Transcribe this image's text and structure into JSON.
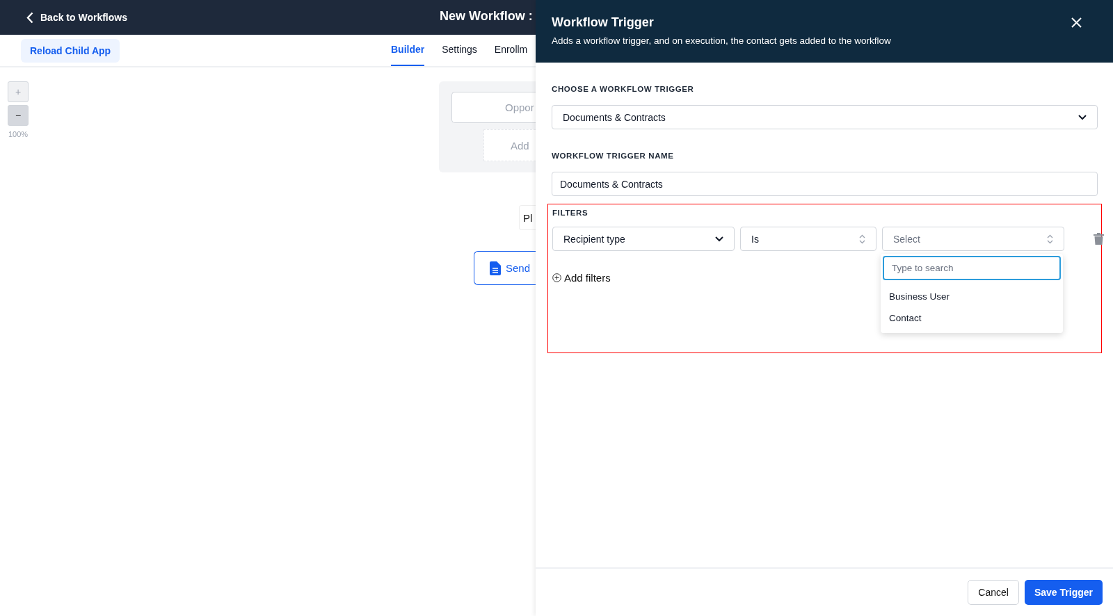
{
  "topbar": {
    "back_label": "Back to Workflows",
    "title": "New Workflow :"
  },
  "toolbar": {
    "reload_button": "Reload Child App",
    "tabs": [
      {
        "label": "Builder",
        "selected": true
      },
      {
        "label": "Settings",
        "selected": false
      },
      {
        "label": "Enrollm",
        "selected": false
      }
    ]
  },
  "zoom": {
    "buttons": [
      {
        "label": "+",
        "disabled": true
      },
      {
        "label": "−",
        "disabled": false
      }
    ],
    "level_text": "100%"
  },
  "canvas": {
    "trigger_node": "Oppor",
    "add_trigger": "Add",
    "placeholder_node": "Pl",
    "action_node": "Send"
  },
  "panel": {
    "title": "Workflow Trigger",
    "subtitle": "Adds a workflow trigger, and on execution, the contact gets added to the workflow",
    "trigger_label": "CHOOSE A WORKFLOW TRIGGER",
    "trigger_value": "Documents & Contracts",
    "name_label": "WORKFLOW TRIGGER NAME",
    "name_value": "Documents & Contracts",
    "filters": {
      "label": "FILTERS",
      "highlighted": true,
      "field": "Recipient type",
      "operator": "Is",
      "value_placeholder": "Select",
      "dropdown": {
        "search_placeholder": "Type to search",
        "options": [
          {
            "label": "Business User",
            "selected": false
          },
          {
            "label": "Contact",
            "selected": false
          }
        ]
      },
      "add_label": "Add filters"
    },
    "buttons": {
      "cancel": "Cancel",
      "save": "Save Trigger"
    }
  }
}
